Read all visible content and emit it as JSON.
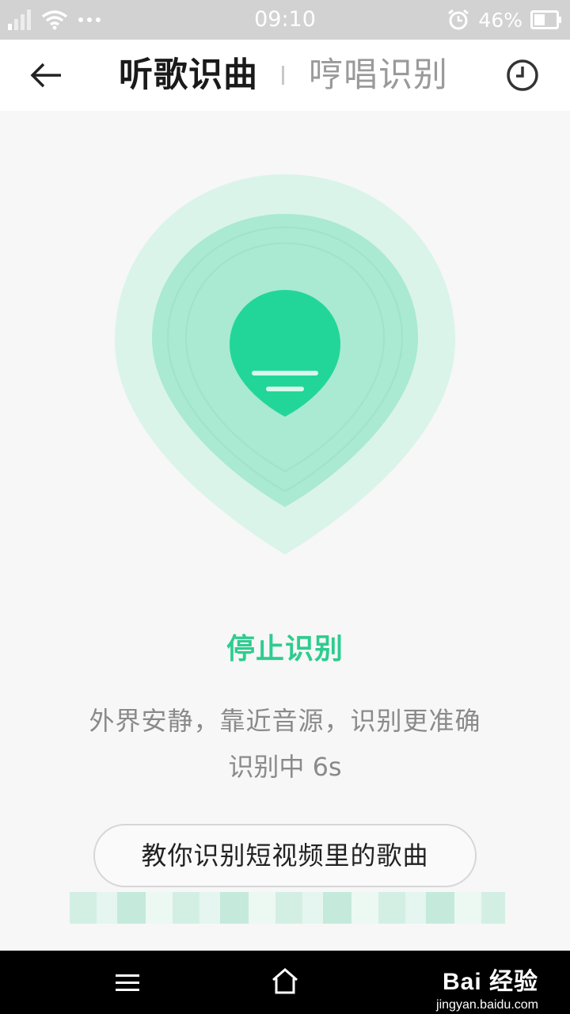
{
  "status_bar": {
    "time": "09:10",
    "battery_percent": "46%"
  },
  "header": {
    "tab_active": "听歌识曲",
    "tab_inactive": "哼唱识别"
  },
  "main": {
    "stop_label": "停止识别",
    "hint": "外界安静，靠近音源，识别更准确",
    "progress": "识别中 6s",
    "tutorial_button": "教你识别短视频里的歌曲"
  },
  "watermark": {
    "logo": "Bai 经验",
    "url": "jingyan.baidu.com"
  },
  "colors": {
    "accent": "#2ecc8f",
    "pin_inner": "#22d69a"
  }
}
